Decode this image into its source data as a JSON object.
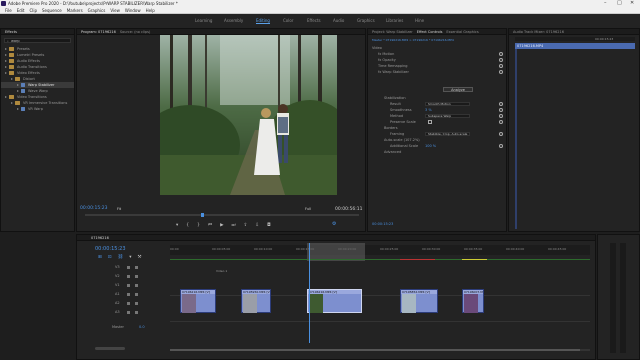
{
  "app": {
    "title": "Adobe Premiere Pro 2020 - D:\\Youtube\\projects\\PrWARP STABILIZER\\Warp Stabilizer *",
    "window_controls": [
      "–",
      "□",
      "✕"
    ]
  },
  "menu": [
    "File",
    "Edit",
    "Clip",
    "Sequence",
    "Markers",
    "Graphics",
    "View",
    "Window",
    "Help"
  ],
  "workspaces": {
    "items": [
      "Learning",
      "Assembly",
      "Editing",
      "Color",
      "Effects",
      "Audio",
      "Graphics",
      "Libraries",
      "Hine"
    ],
    "active": "Editing"
  },
  "effects_panel": {
    "tab": "Effects",
    "search_value": "warp",
    "tree": [
      {
        "label": "Presets",
        "level": 0
      },
      {
        "label": "Lumetri Presets",
        "level": 0
      },
      {
        "label": "Audio Effects",
        "level": 0
      },
      {
        "label": "Audio Transitions",
        "level": 0
      },
      {
        "label": "Video Effects",
        "level": 0
      },
      {
        "label": "Distort",
        "level": 1
      },
      {
        "label": "Warp Stabilizer",
        "level": 2,
        "selected": true
      },
      {
        "label": "Wave Warp",
        "level": 2
      },
      {
        "label": "Video Transitions",
        "level": 0
      },
      {
        "label": "VR Immersive Transitions",
        "level": 1
      },
      {
        "label": "VR Warp",
        "level": 2
      }
    ]
  },
  "program": {
    "tabs": [
      "Program: 07196216",
      "Source: (no clips)"
    ],
    "timecode_current": "00:00:15:23",
    "fit": "Fit",
    "quality": "Full",
    "timecode_duration": "00:00:56:11"
  },
  "effect_controls": {
    "tabs": [
      "Project: Warp Stabilizer",
      "Effect Controls",
      "Essential Graphics",
      "Audio Track Mixer: 07196216"
    ],
    "header": "Master * 07196216.MP4  >  07196216 * 07196216.MP4",
    "sections": [
      {
        "label": "Video",
        "kind": "heading"
      },
      {
        "label": "fx  Motion",
        "kind": "fx"
      },
      {
        "label": "fx  Opacity",
        "kind": "fx"
      },
      {
        "label": "Time Remapping",
        "kind": "fx"
      },
      {
        "label": "fx  Warp Stabilizer",
        "kind": "fx"
      }
    ],
    "analyze_label": "Analyze",
    "params": [
      {
        "label": "Stabilization",
        "value": ""
      },
      {
        "label": "Result",
        "value": "Smooth Motion",
        "type": "dropdown"
      },
      {
        "label": "Smoothness",
        "value": "3 %",
        "type": "blue"
      },
      {
        "label": "Method",
        "value": "Subspace Warp",
        "type": "dropdown"
      },
      {
        "label": "Preserve Scale",
        "value": "",
        "type": "checkbox"
      },
      {
        "label": "Borders",
        "value": ""
      },
      {
        "label": "Framing",
        "value": "Stabilize, Crop, Auto-scale",
        "type": "dropdown"
      },
      {
        "label": "Auto-scale (107.2%)",
        "value": ""
      },
      {
        "label": "Additional Scale",
        "value": "100 %",
        "type": "blue"
      },
      {
        "label": "Advanced",
        "value": ""
      }
    ],
    "mini_timecode": "00:00:15:23"
  },
  "audio_track_mixer": {
    "clip_label": "07196216.MP4",
    "time_label": "00:00:15:23"
  },
  "timeline": {
    "tab": "07196216",
    "timecode": "00:00:15:23",
    "ruler": [
      "00:00",
      "00:00:05:00",
      "00:00:10:00",
      "00:00:15:00",
      "00:00:20:00",
      "00:00:25:00",
      "00:00:30:00",
      "00:00:35:00",
      "00:00:40:00",
      "00:00:45:00"
    ],
    "tracks": [
      "V3",
      "V2",
      "V1",
      "A1",
      "A2",
      "A3"
    ],
    "video_track_label": "Video 1",
    "master_label": "Master",
    "master_value": "0.0",
    "clips": [
      {
        "label": "07196216.MP4 [V]"
      },
      {
        "label": "07195950.MP4 [V]"
      },
      {
        "label": "07196216.MP4 [V]"
      },
      {
        "label": "07195852.MP4 [V]"
      },
      {
        "label": "07196007.MP4 [V]"
      }
    ]
  },
  "colors": {
    "accent_blue": "#4a90e0",
    "clip_blue": "#7d8fcf",
    "panel_bg": "#232323",
    "titlebar": "#f0f0f0"
  }
}
